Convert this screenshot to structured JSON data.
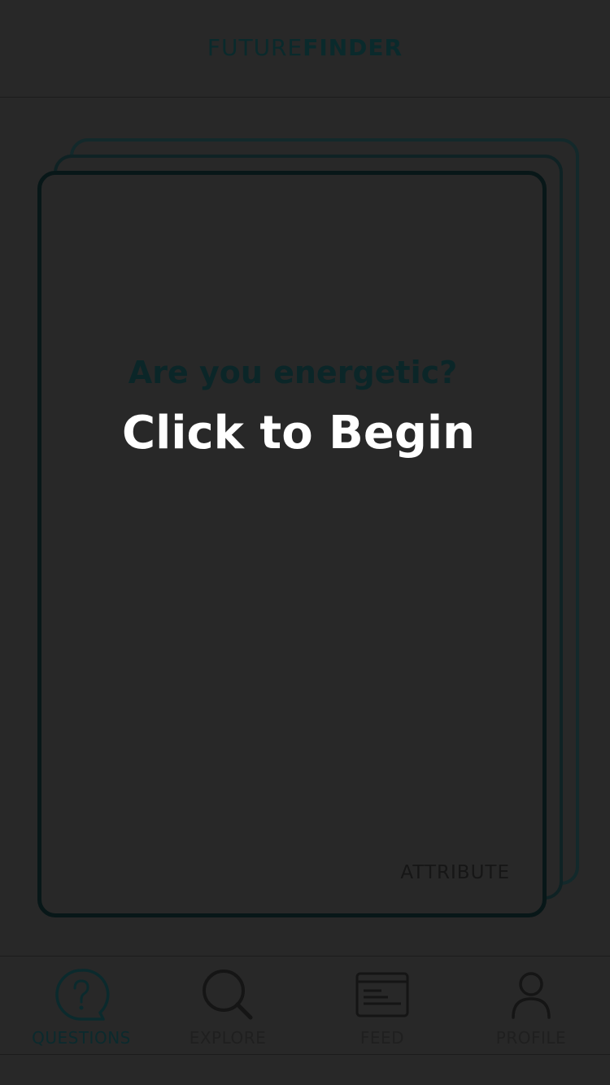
{
  "header": {
    "logo_light": "FUTURE",
    "logo_bold": "FINDER"
  },
  "card": {
    "question": "Are you energetic?",
    "cta": "Click to Begin",
    "category": "ATTRIBUTE"
  },
  "tabbar": {
    "tabs": [
      {
        "label": "QUESTIONS",
        "icon": "question-bubble-icon",
        "active": true
      },
      {
        "label": "EXPLORE",
        "icon": "search-icon",
        "active": false
      },
      {
        "label": "FEED",
        "icon": "feed-icon",
        "active": false
      },
      {
        "label": "PROFILE",
        "icon": "person-icon",
        "active": false
      }
    ]
  },
  "colors": {
    "background": "#282828",
    "accent_dark_teal": "#0b2a2d",
    "cta_text": "#ffffff"
  }
}
